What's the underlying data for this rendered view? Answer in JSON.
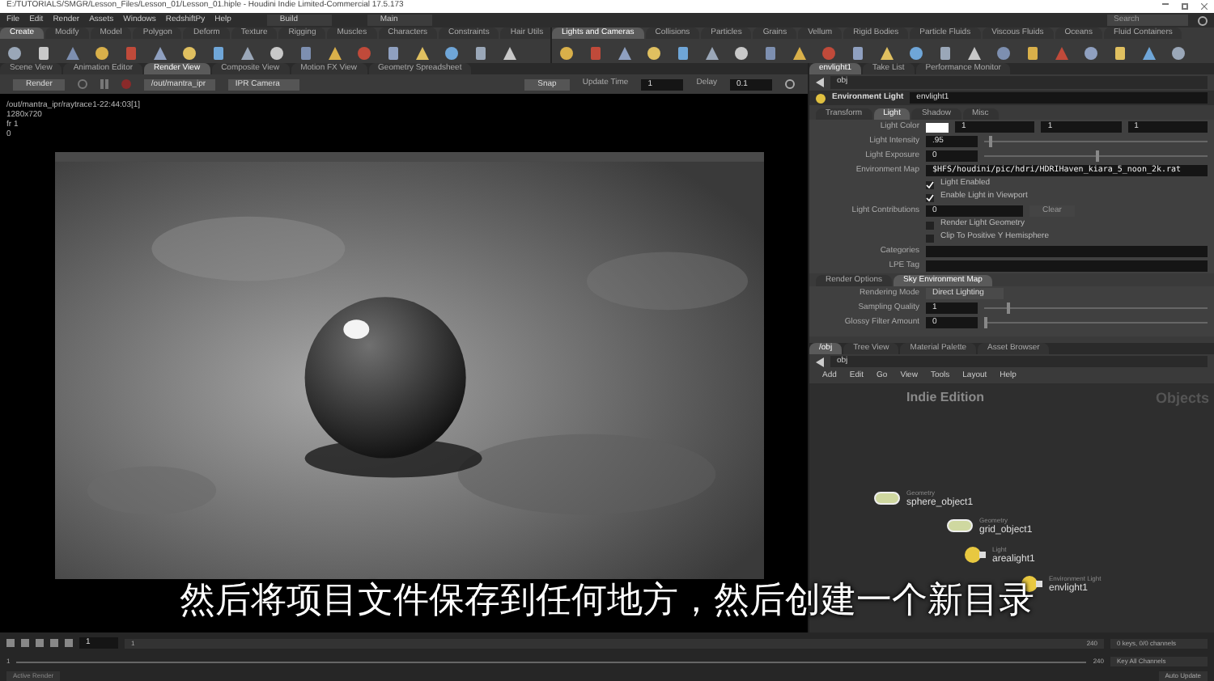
{
  "window": {
    "title": "E:/TUTORIALS/SMGR/Lesson_Files/Lesson_01/Lesson_01.hiple - Houdini Indie Limited-Commercial 17.5.173",
    "search": "Search"
  },
  "menu": [
    "File",
    "Edit",
    "Render",
    "Assets",
    "Windows",
    "RedshiftPy",
    "Help"
  ],
  "desktops": [
    {
      "label": "Build"
    },
    {
      "label": "Main"
    }
  ],
  "shelf_tabs": [
    {
      "label": "Create",
      "selected": true
    },
    {
      "label": "Modify",
      "selected": false
    },
    {
      "label": "Model",
      "selected": false
    },
    {
      "label": "Polygon",
      "selected": false
    },
    {
      "label": "Deform",
      "selected": false
    },
    {
      "label": "Texture",
      "selected": false
    },
    {
      "label": "Rigging",
      "selected": false
    },
    {
      "label": "Muscles",
      "selected": false
    },
    {
      "label": "Characters",
      "selected": false
    },
    {
      "label": "Constraints",
      "selected": false
    },
    {
      "label": "Hair Utils",
      "selected": false
    }
  ],
  "shelf_tabs_right": [
    {
      "label": "Lights and Cameras",
      "selected": true
    },
    {
      "label": "Collisions",
      "selected": false
    },
    {
      "label": "Particles",
      "selected": false
    },
    {
      "label": "Grains",
      "selected": false
    },
    {
      "label": "Vellum",
      "selected": false
    },
    {
      "label": "Rigid Bodies",
      "selected": false
    },
    {
      "label": "Particle Fluids",
      "selected": false
    },
    {
      "label": "Viscous Fluids",
      "selected": false
    },
    {
      "label": "Oceans",
      "selected": false
    },
    {
      "label": "Fluid Containers",
      "selected": false
    }
  ],
  "pane_tabs": [
    {
      "label": "Scene View",
      "selected": false
    },
    {
      "label": "Animation Editor",
      "selected": false
    },
    {
      "label": "Render View",
      "selected": true
    },
    {
      "label": "Composite View",
      "selected": false
    },
    {
      "label": "Motion FX View",
      "selected": false
    },
    {
      "label": "Geometry Spreadsheet",
      "selected": false
    }
  ],
  "render_toolbar": {
    "render": "Render",
    "driver": "/out/mantra_ipr",
    "camera": "IPR Camera",
    "snap": "Snap",
    "update_label": "Update Time",
    "update_value": "1",
    "delay_label": "Delay",
    "delay_value": "0.1"
  },
  "viewport": {
    "info": [
      "/out/mantra_ipr/raytrace1-22:44:03[1]",
      "1280x720",
      "fr 1",
      "0"
    ]
  },
  "right_tabs": [
    {
      "label": "envlight1",
      "selected": true
    },
    {
      "label": "Take List",
      "selected": false
    },
    {
      "label": "Performance Monitor",
      "selected": false
    }
  ],
  "obj_path": "obj",
  "node_header": {
    "type": "Environment Light",
    "name": "envlight1"
  },
  "param_tabs": [
    {
      "label": "Transform",
      "selected": false
    },
    {
      "label": "Light",
      "selected": true
    },
    {
      "label": "Shadow",
      "selected": false
    },
    {
      "label": "Misc",
      "selected": false
    }
  ],
  "params": [
    {
      "kind": "color",
      "label": "Light Color",
      "values": [
        "1",
        "1",
        "1"
      ]
    },
    {
      "kind": "slider",
      "label": "Light Intensity",
      "value": ".95",
      "level": 0.02
    },
    {
      "kind": "slider",
      "label": "Light Exposure",
      "value": "0",
      "level": 0.5
    },
    {
      "kind": "file",
      "label": "Environment Map",
      "value": "$HFS/houdini/pic/hdri/HDRIHaven_kiara_5_noon_2k.rat"
    },
    {
      "kind": "checkbox",
      "text": "Light Enabled",
      "checked": true
    },
    {
      "kind": "checkbox",
      "text": "Enable Light in Viewport",
      "checked": true
    },
    {
      "kind": "count",
      "label": "Light Contributions",
      "value": "0",
      "button": "Clear"
    },
    {
      "kind": "checkbox",
      "text": "Render Light Geometry",
      "checked": false
    },
    {
      "kind": "checkbox",
      "text": "Clip To Positive Y Hemisphere",
      "checked": false
    },
    {
      "kind": "text",
      "label": "Categories"
    },
    {
      "kind": "text",
      "label": "LPE Tag"
    }
  ],
  "sub_tabs": [
    {
      "label": "Render Options",
      "selected": false
    },
    {
      "label": "Sky Environment Map",
      "selected": true
    }
  ],
  "sub_params": [
    {
      "kind": "menu",
      "label": "Rendering Mode",
      "value": "Direct Lighting"
    },
    {
      "kind": "slider",
      "label": "Sampling Quality",
      "value": "1",
      "level": 0.1
    },
    {
      "kind": "slider",
      "label": "Glossy Filter Amount",
      "value": "0",
      "level": 0.0
    }
  ],
  "network_tabs": [
    {
      "label": "/obj",
      "selected": true
    },
    {
      "label": "Tree View",
      "selected": false
    },
    {
      "label": "Material Palette",
      "selected": false
    },
    {
      "label": "Asset Browser",
      "selected": false
    }
  ],
  "network_path": "obj",
  "network_menu": [
    "Add",
    "Edit",
    "Go",
    "View",
    "Tools",
    "Layout",
    "Help"
  ],
  "network": {
    "edition": "Indie Edition",
    "context": "Objects",
    "nodes": [
      {
        "kind": "geo",
        "label": "sphere_object1",
        "type": "Geometry"
      },
      {
        "kind": "geo",
        "label": "grid_object1",
        "type": "Geometry"
      },
      {
        "kind": "light",
        "label": "arealight1",
        "type": "Light"
      },
      {
        "kind": "light",
        "label": "envlight1",
        "type": "Environment Light"
      }
    ]
  },
  "subtitle": "然后将项目文件保存到任何地方，然后创建一个新目录",
  "timeline": {
    "frame": "1",
    "start": "1",
    "start2": "1",
    "end": "240",
    "end2": "240",
    "channels": "0 keys, 0/0 channels",
    "key_all": "Key All Channels",
    "auto_update": "Auto Update",
    "active_render": "Active Render"
  }
}
